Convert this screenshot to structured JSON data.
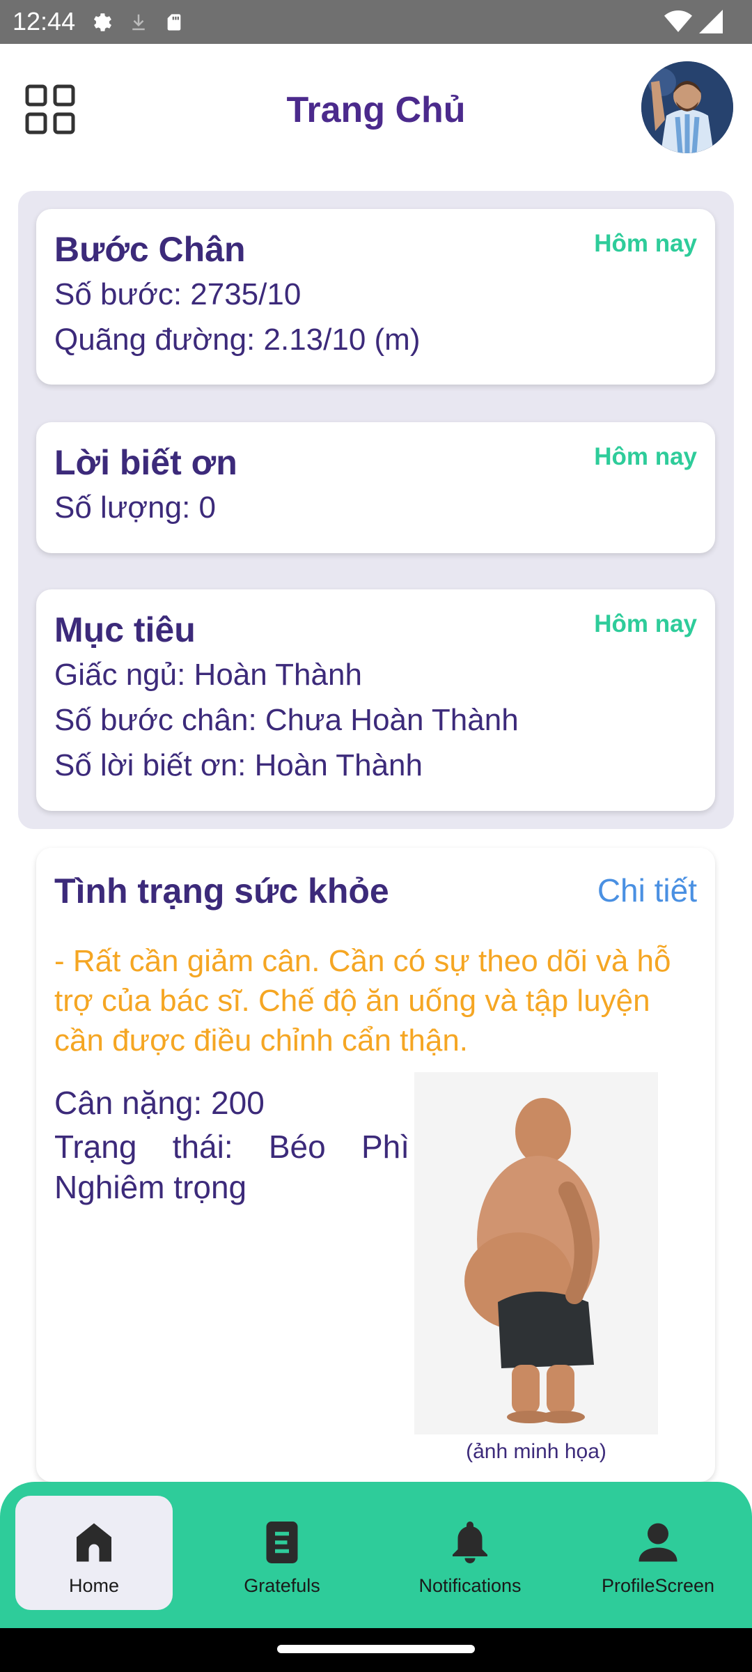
{
  "status_bar": {
    "time": "12:44"
  },
  "header": {
    "title": "Trang Chủ"
  },
  "cards": {
    "steps": {
      "title": "Bước Chân",
      "badge": "Hôm nay",
      "line1": "Số bước: 2735/10",
      "line2": "Quãng đường: 2.13/10 (m)"
    },
    "gratitude": {
      "title": "Lời biết ơn",
      "badge": "Hôm nay",
      "line1": "Số lượng: 0"
    },
    "goals": {
      "title": "Mục tiêu",
      "badge": "Hôm nay",
      "line1": "Giấc ngủ: Hoàn Thành",
      "line2": "Số bước chân: Chưa Hoàn Thành",
      "line3": "Số lời biết ơn: Hoàn Thành"
    }
  },
  "health": {
    "title": "Tình trạng sức khỏe",
    "detail_link": "Chi tiết",
    "advice": "- Rất cần giảm cân. Cần có sự theo dõi và hỗ trợ của bác sĩ. Chế độ ăn uống và tập luyện cần được điều chỉnh cẩn thận.",
    "weight": "Cân nặng: 200",
    "status": "Trạng thái: Béo Phì Nghiêm trọng",
    "caption": "(ảnh minh họa)"
  },
  "bottom_nav": [
    {
      "label": "Home",
      "icon": "home-icon",
      "active": true
    },
    {
      "label": "Gratefuls",
      "icon": "document-icon",
      "active": false
    },
    {
      "label": "Notifications",
      "icon": "bell-icon",
      "active": false
    },
    {
      "label": "ProfileScreen",
      "icon": "person-icon",
      "active": false
    }
  ],
  "colors": {
    "primary": "#3c2a7a",
    "accent": "#2ecc9a",
    "warning": "#f5a623",
    "link": "#4a90e2"
  }
}
